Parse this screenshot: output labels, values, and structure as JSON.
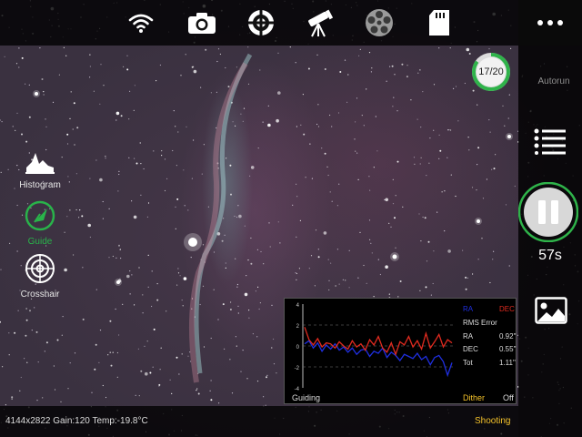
{
  "toolbar": {
    "icons": [
      "wifi-icon",
      "camera-icon",
      "focus-target-icon",
      "telescope-icon",
      "filter-wheel-icon",
      "sd-card-icon"
    ],
    "more_icon": "more-dots-icon"
  },
  "progress": {
    "label": "17/20",
    "current": 17,
    "total": 20,
    "color": "#2fb34a"
  },
  "autorun": {
    "label": "Autorun"
  },
  "exposure": {
    "remaining": "57s"
  },
  "tools": {
    "histogram": "Histogram",
    "guide": "Guide",
    "crosshair": "Crosshair"
  },
  "guiding": {
    "title": "Guiding",
    "legend_ra": "RA",
    "legend_dec": "DEC",
    "rms_title": "RMS Error",
    "rms": [
      {
        "label": "RA",
        "value": "0.92\""
      },
      {
        "label": "DEC",
        "value": "0.55\""
      },
      {
        "label": "Tot",
        "value": "1.11\""
      }
    ],
    "y_ticks": [
      "4",
      "2",
      "0",
      "-2",
      "-4"
    ],
    "dither_label": "Dither",
    "dither_value": "Off",
    "ra_color": "#1f2fe0",
    "dec_color": "#e02a1f"
  },
  "chart_data": {
    "type": "line",
    "title": "Guiding",
    "xlabel": "",
    "ylabel": "",
    "ylim": [
      -4,
      4
    ],
    "y_ticks": [
      4,
      2,
      0,
      -2,
      -4
    ],
    "series": [
      {
        "name": "RA",
        "values": [
          0.2,
          0.5,
          -0.2,
          0.3,
          -0.5,
          0.1,
          -0.3,
          0.2,
          -0.4,
          -0.1,
          -0.6,
          -0.2,
          -0.8,
          -0.4,
          -0.3,
          -1.0,
          -0.5,
          -0.7,
          -0.2,
          -1.1,
          -0.6,
          -0.9,
          -1.4,
          -0.8,
          -1.0,
          -1.2,
          -0.7,
          -1.3,
          -1.0,
          -1.8,
          -1.1,
          -0.9,
          -1.5,
          -2.8,
          -1.6
        ]
      },
      {
        "name": "DEC",
        "values": [
          1.8,
          0.6,
          0.1,
          0.7,
          -0.1,
          0.3,
          0.2,
          -0.2,
          0.4,
          0.0,
          -0.3,
          0.5,
          -0.1,
          0.2,
          -0.4,
          0.6,
          0.1,
          0.9,
          -0.2,
          -0.6,
          0.3,
          -0.8,
          0.4,
          0.1,
          0.9,
          -0.1,
          0.5,
          -0.3,
          1.2,
          -0.2,
          0.4,
          1.1,
          -0.1,
          0.6,
          0.3
        ]
      }
    ]
  },
  "status": {
    "image_info": "4144x2822  Gain:120  Temp:-19.8°C",
    "shooting": "Shooting"
  }
}
